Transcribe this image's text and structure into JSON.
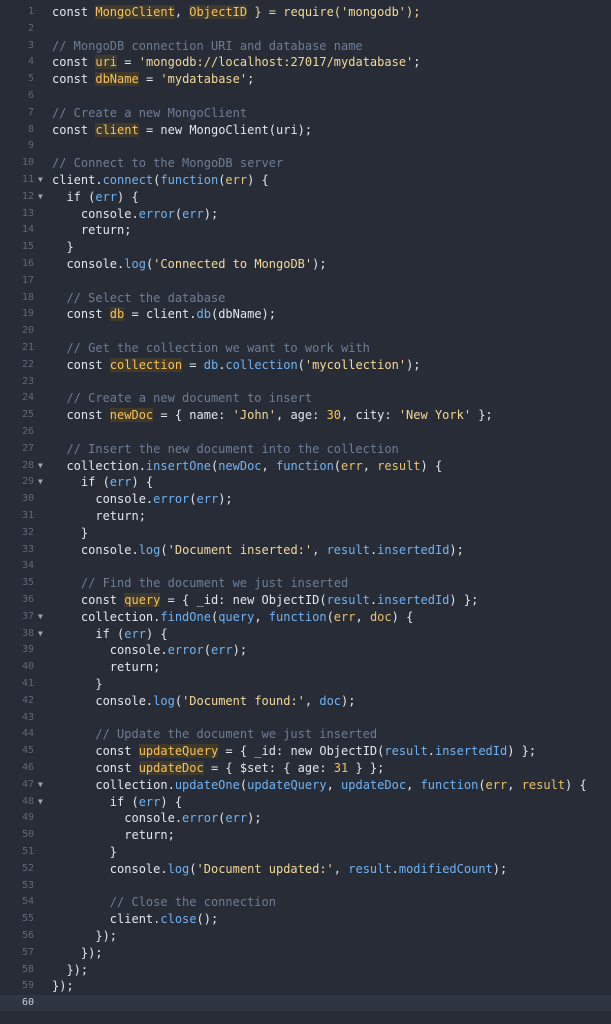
{
  "editor": {
    "active_line": 60,
    "lines": [
      {
        "n": "1",
        "fold": "",
        "s": [
          [
            "const ",
            "kw"
          ],
          [
            "MongoClient",
            "va"
          ],
          [
            ", ",
            "pl"
          ],
          [
            "ObjectID",
            "va"
          ],
          [
            " } = require('mongodb');",
            "st"
          ]
        ]
      },
      {
        "n": "2",
        "fold": "",
        "s": []
      },
      {
        "n": "3",
        "fold": "",
        "s": [
          [
            "// MongoDB connection URI and database name",
            "cm"
          ]
        ]
      },
      {
        "n": "4",
        "fold": "",
        "s": [
          [
            "const ",
            "kw"
          ],
          [
            "uri",
            "va"
          ],
          [
            " = ",
            "pl"
          ],
          [
            "'mongodb://localhost:27017/mydatabase'",
            "st"
          ],
          [
            ";",
            "pl"
          ]
        ]
      },
      {
        "n": "5",
        "fold": "",
        "s": [
          [
            "const ",
            "kw"
          ],
          [
            "dbName",
            "va"
          ],
          [
            " = ",
            "pl"
          ],
          [
            "'mydatabase'",
            "st"
          ],
          [
            ";",
            "pl"
          ]
        ]
      },
      {
        "n": "6",
        "fold": "",
        "s": []
      },
      {
        "n": "7",
        "fold": "",
        "s": [
          [
            "// Create a new MongoClient",
            "cm"
          ]
        ]
      },
      {
        "n": "8",
        "fold": "",
        "s": [
          [
            "const ",
            "kw"
          ],
          [
            "client",
            "va"
          ],
          [
            " = ",
            "pl"
          ],
          [
            "new ",
            "kw"
          ],
          [
            "MongoClient(uri);",
            "pl"
          ]
        ]
      },
      {
        "n": "9",
        "fold": "",
        "s": []
      },
      {
        "n": "10",
        "fold": "",
        "s": [
          [
            "// Connect to the MongoDB server",
            "cm"
          ]
        ]
      },
      {
        "n": "11",
        "fold": "▼",
        "s": [
          [
            "client.",
            "pl"
          ],
          [
            "connect",
            "fn"
          ],
          [
            "(",
            "pl"
          ],
          [
            "function",
            "fn"
          ],
          [
            "(",
            "pl"
          ],
          [
            "err",
            "pa"
          ],
          [
            ") {",
            "pl"
          ]
        ]
      },
      {
        "n": "12",
        "fold": "▼",
        "s": [
          [
            "  if (",
            "pl"
          ],
          [
            "err",
            "fn"
          ],
          [
            ") {",
            "pl"
          ]
        ]
      },
      {
        "n": "13",
        "fold": "",
        "s": [
          [
            "    console.",
            "pl"
          ],
          [
            "error",
            "fn"
          ],
          [
            "(",
            "pl"
          ],
          [
            "err",
            "fn"
          ],
          [
            ");",
            "pl"
          ]
        ]
      },
      {
        "n": "14",
        "fold": "",
        "s": [
          [
            "    return;",
            "pl"
          ]
        ]
      },
      {
        "n": "15",
        "fold": "",
        "s": [
          [
            "  }",
            "pl"
          ]
        ]
      },
      {
        "n": "16",
        "fold": "",
        "s": [
          [
            "  console.",
            "pl"
          ],
          [
            "log",
            "fn"
          ],
          [
            "(",
            "pl"
          ],
          [
            "'Connected to MongoDB'",
            "st"
          ],
          [
            ");",
            "pl"
          ]
        ]
      },
      {
        "n": "17",
        "fold": "",
        "s": []
      },
      {
        "n": "18",
        "fold": "",
        "s": [
          [
            "  // Select the database",
            "cm"
          ]
        ]
      },
      {
        "n": "19",
        "fold": "",
        "s": [
          [
            "  const ",
            "kw"
          ],
          [
            "db",
            "va"
          ],
          [
            " = ",
            "pl"
          ],
          [
            "client.",
            "pl"
          ],
          [
            "db",
            "fn"
          ],
          [
            "(dbName);",
            "pl"
          ]
        ]
      },
      {
        "n": "20",
        "fold": "",
        "s": []
      },
      {
        "n": "21",
        "fold": "",
        "s": [
          [
            "  // Get the collection we want to work with",
            "cm"
          ]
        ]
      },
      {
        "n": "22",
        "fold": "",
        "s": [
          [
            "  const ",
            "kw"
          ],
          [
            "collection",
            "va"
          ],
          [
            " = ",
            "pl"
          ],
          [
            "db",
            "fn"
          ],
          [
            ".",
            "pl"
          ],
          [
            "collection",
            "fn"
          ],
          [
            "(",
            "pl"
          ],
          [
            "'mycollection'",
            "st"
          ],
          [
            ");",
            "pl"
          ]
        ]
      },
      {
        "n": "23",
        "fold": "",
        "s": []
      },
      {
        "n": "24",
        "fold": "",
        "s": [
          [
            "  // Create a new document to insert",
            "cm"
          ]
        ]
      },
      {
        "n": "25",
        "fold": "",
        "s": [
          [
            "  const ",
            "kw"
          ],
          [
            "newDoc",
            "va"
          ],
          [
            " = { name: ",
            "pl"
          ],
          [
            "'John'",
            "st"
          ],
          [
            ", age: ",
            "pl"
          ],
          [
            "30",
            "nu"
          ],
          [
            ", city: ",
            "pl"
          ],
          [
            "'New York'",
            "st"
          ],
          [
            " };",
            "pl"
          ]
        ]
      },
      {
        "n": "26",
        "fold": "",
        "s": []
      },
      {
        "n": "27",
        "fold": "",
        "s": [
          [
            "  // Insert the new document into the collection",
            "cm"
          ]
        ]
      },
      {
        "n": "28",
        "fold": "▼",
        "s": [
          [
            "  collection.",
            "pl"
          ],
          [
            "insertOne",
            "fn"
          ],
          [
            "(",
            "pl"
          ],
          [
            "newDoc",
            "fn"
          ],
          [
            ", ",
            "pl"
          ],
          [
            "function",
            "fn"
          ],
          [
            "(",
            "pl"
          ],
          [
            "err",
            "pa"
          ],
          [
            ", ",
            "pl"
          ],
          [
            "result",
            "pa"
          ],
          [
            ") {",
            "pl"
          ]
        ]
      },
      {
        "n": "29",
        "fold": "▼",
        "s": [
          [
            "    if (",
            "pl"
          ],
          [
            "err",
            "fn"
          ],
          [
            ") {",
            "pl"
          ]
        ]
      },
      {
        "n": "30",
        "fold": "",
        "s": [
          [
            "      console.",
            "pl"
          ],
          [
            "error",
            "fn"
          ],
          [
            "(",
            "pl"
          ],
          [
            "err",
            "fn"
          ],
          [
            ");",
            "pl"
          ]
        ]
      },
      {
        "n": "31",
        "fold": "",
        "s": [
          [
            "      return;",
            "pl"
          ]
        ]
      },
      {
        "n": "32",
        "fold": "",
        "s": [
          [
            "    }",
            "pl"
          ]
        ]
      },
      {
        "n": "33",
        "fold": "",
        "s": [
          [
            "    console.",
            "pl"
          ],
          [
            "log",
            "fn"
          ],
          [
            "(",
            "pl"
          ],
          [
            "'Document inserted:'",
            "st"
          ],
          [
            ", ",
            "pl"
          ],
          [
            "result",
            "fn"
          ],
          [
            ".",
            "pl"
          ],
          [
            "insertedId",
            "fn"
          ],
          [
            ");",
            "pl"
          ]
        ]
      },
      {
        "n": "34",
        "fold": "",
        "s": []
      },
      {
        "n": "35",
        "fold": "",
        "s": [
          [
            "    // Find the document we just inserted",
            "cm"
          ]
        ]
      },
      {
        "n": "36",
        "fold": "",
        "s": [
          [
            "    const ",
            "kw"
          ],
          [
            "query",
            "va"
          ],
          [
            " = { _id: ",
            "pl"
          ],
          [
            "new ",
            "kw"
          ],
          [
            "ObjectID(",
            "pl"
          ],
          [
            "result",
            "fn"
          ],
          [
            ".",
            "pl"
          ],
          [
            "insertedId",
            "fn"
          ],
          [
            ") };",
            "pl"
          ]
        ]
      },
      {
        "n": "37",
        "fold": "▼",
        "s": [
          [
            "    collection.",
            "pl"
          ],
          [
            "findOne",
            "fn"
          ],
          [
            "(",
            "pl"
          ],
          [
            "query",
            "fn"
          ],
          [
            ", ",
            "pl"
          ],
          [
            "function",
            "fn"
          ],
          [
            "(",
            "pl"
          ],
          [
            "err",
            "pa"
          ],
          [
            ", ",
            "pl"
          ],
          [
            "doc",
            "pa"
          ],
          [
            ") {",
            "pl"
          ]
        ]
      },
      {
        "n": "38",
        "fold": "▼",
        "s": [
          [
            "      if (",
            "pl"
          ],
          [
            "err",
            "fn"
          ],
          [
            ") {",
            "pl"
          ]
        ]
      },
      {
        "n": "39",
        "fold": "",
        "s": [
          [
            "        console.",
            "pl"
          ],
          [
            "error",
            "fn"
          ],
          [
            "(",
            "pl"
          ],
          [
            "err",
            "fn"
          ],
          [
            ");",
            "pl"
          ]
        ]
      },
      {
        "n": "40",
        "fold": "",
        "s": [
          [
            "        return;",
            "pl"
          ]
        ]
      },
      {
        "n": "41",
        "fold": "",
        "s": [
          [
            "      }",
            "pl"
          ]
        ]
      },
      {
        "n": "42",
        "fold": "",
        "s": [
          [
            "      console.",
            "pl"
          ],
          [
            "log",
            "fn"
          ],
          [
            "(",
            "pl"
          ],
          [
            "'Document found:'",
            "st"
          ],
          [
            ", ",
            "pl"
          ],
          [
            "doc",
            "fn"
          ],
          [
            ");",
            "pl"
          ]
        ]
      },
      {
        "n": "43",
        "fold": "",
        "s": []
      },
      {
        "n": "44",
        "fold": "",
        "s": [
          [
            "      // Update the document we just inserted",
            "cm"
          ]
        ]
      },
      {
        "n": "45",
        "fold": "",
        "s": [
          [
            "      const ",
            "kw"
          ],
          [
            "updateQuery",
            "va"
          ],
          [
            " = { _id: ",
            "pl"
          ],
          [
            "new ",
            "kw"
          ],
          [
            "ObjectID(",
            "pl"
          ],
          [
            "result",
            "fn"
          ],
          [
            ".",
            "pl"
          ],
          [
            "insertedId",
            "fn"
          ],
          [
            ") };",
            "pl"
          ]
        ]
      },
      {
        "n": "46",
        "fold": "",
        "s": [
          [
            "      const ",
            "kw"
          ],
          [
            "updateDoc",
            "va"
          ],
          [
            " = { $set: { age: ",
            "pl"
          ],
          [
            "31",
            "nu"
          ],
          [
            " } };",
            "pl"
          ]
        ]
      },
      {
        "n": "47",
        "fold": "▼",
        "s": [
          [
            "      collection.",
            "pl"
          ],
          [
            "updateOne",
            "fn"
          ],
          [
            "(",
            "pl"
          ],
          [
            "updateQuery",
            "fn"
          ],
          [
            ", ",
            "pl"
          ],
          [
            "updateDoc",
            "fn"
          ],
          [
            ", ",
            "pl"
          ],
          [
            "function",
            "fn"
          ],
          [
            "(",
            "pl"
          ],
          [
            "err",
            "pa"
          ],
          [
            ", ",
            "pl"
          ],
          [
            "result",
            "pa"
          ],
          [
            ") {",
            "pl"
          ]
        ]
      },
      {
        "n": "48",
        "fold": "▼",
        "s": [
          [
            "        if (",
            "pl"
          ],
          [
            "err",
            "fn"
          ],
          [
            ") {",
            "pl"
          ]
        ]
      },
      {
        "n": "49",
        "fold": "",
        "s": [
          [
            "          console.",
            "pl"
          ],
          [
            "error",
            "fn"
          ],
          [
            "(",
            "pl"
          ],
          [
            "err",
            "fn"
          ],
          [
            ");",
            "pl"
          ]
        ]
      },
      {
        "n": "50",
        "fold": "",
        "s": [
          [
            "          return;",
            "pl"
          ]
        ]
      },
      {
        "n": "51",
        "fold": "",
        "s": [
          [
            "        }",
            "pl"
          ]
        ]
      },
      {
        "n": "52",
        "fold": "",
        "s": [
          [
            "        console.",
            "pl"
          ],
          [
            "log",
            "fn"
          ],
          [
            "(",
            "pl"
          ],
          [
            "'Document updated:'",
            "st"
          ],
          [
            ", ",
            "pl"
          ],
          [
            "result",
            "fn"
          ],
          [
            ".",
            "pl"
          ],
          [
            "modifiedCount",
            "fn"
          ],
          [
            ");",
            "pl"
          ]
        ]
      },
      {
        "n": "53",
        "fold": "",
        "s": []
      },
      {
        "n": "54",
        "fold": "",
        "s": [
          [
            "        // Close the connection",
            "cm"
          ]
        ]
      },
      {
        "n": "55",
        "fold": "",
        "s": [
          [
            "        client.",
            "pl"
          ],
          [
            "close",
            "fn"
          ],
          [
            "();",
            "pl"
          ]
        ]
      },
      {
        "n": "56",
        "fold": "",
        "s": [
          [
            "      });",
            "pl"
          ]
        ]
      },
      {
        "n": "57",
        "fold": "",
        "s": [
          [
            "    });",
            "pl"
          ]
        ]
      },
      {
        "n": "58",
        "fold": "",
        "s": [
          [
            "  });",
            "pl"
          ]
        ]
      },
      {
        "n": "59",
        "fold": "",
        "s": [
          [
            "});",
            "pl"
          ]
        ]
      },
      {
        "n": "60",
        "fold": "",
        "s": []
      }
    ]
  }
}
